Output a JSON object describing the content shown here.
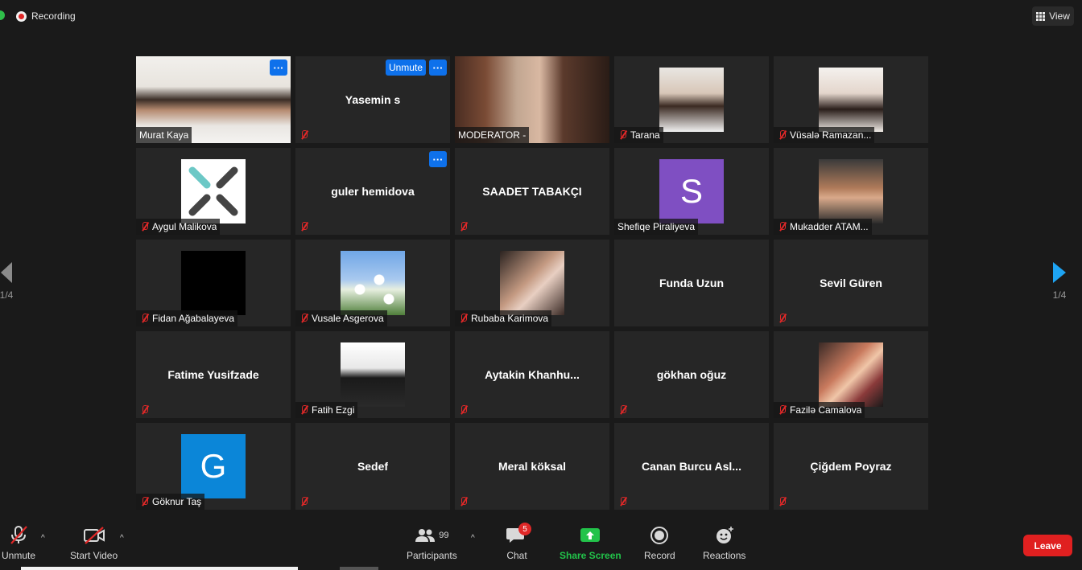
{
  "topbar": {
    "recording_label": "Recording",
    "view_label": "View"
  },
  "pager": {
    "left": "1/4",
    "right": "1/4"
  },
  "tiles": [
    {
      "name": "Murat Kaya",
      "muted": false,
      "kind": "video",
      "dots": true
    },
    {
      "name": "",
      "center": "Yasemin s",
      "muted": true,
      "kind": "name",
      "dots": true,
      "unmute": "Unmute"
    },
    {
      "name": "MODERATOR -",
      "muted": false,
      "kind": "video",
      "active": true
    },
    {
      "name": "Tarana",
      "muted": true,
      "kind": "photo"
    },
    {
      "name": "Vüsalə Ramazan...",
      "muted": true,
      "kind": "photo"
    },
    {
      "name": "Aygul Malikova",
      "muted": true,
      "kind": "photo"
    },
    {
      "name": "",
      "center": "guler hemidova",
      "muted": true,
      "kind": "name",
      "dots": true
    },
    {
      "name": "",
      "center": "SAADET TABAKÇI",
      "muted": true,
      "kind": "name"
    },
    {
      "name": "Shefiqe Piraliyeva",
      "muted": false,
      "kind": "letter",
      "letter": "S",
      "color": "#7f4fc2"
    },
    {
      "name": "Mukadder ATAM...",
      "muted": true,
      "kind": "photo"
    },
    {
      "name": "Fidan Ağabalayeva",
      "muted": true,
      "kind": "photo"
    },
    {
      "name": "Vusale Asgerova",
      "muted": true,
      "kind": "photo"
    },
    {
      "name": "Rubaba Karimova",
      "muted": true,
      "kind": "photo"
    },
    {
      "name": "",
      "center": "Funda Uzun",
      "muted": false,
      "kind": "name"
    },
    {
      "name": "",
      "center": "Sevil Güren",
      "muted": true,
      "kind": "name"
    },
    {
      "name": "",
      "center": "Fatime Yusifzade",
      "muted": true,
      "kind": "name"
    },
    {
      "name": "Fatih Ezgi",
      "muted": true,
      "kind": "photo"
    },
    {
      "name": "",
      "center": "Aytakin  Khanhu...",
      "muted": true,
      "kind": "name"
    },
    {
      "name": "",
      "center": "gökhan oğuz",
      "muted": true,
      "kind": "name"
    },
    {
      "name": "Fazilə Camalova",
      "muted": true,
      "kind": "photo"
    },
    {
      "name": "Göknur Taş",
      "muted": true,
      "kind": "letter",
      "letter": "G",
      "color": "#0b86d8"
    },
    {
      "name": "",
      "center": "Sedef",
      "muted": true,
      "kind": "name"
    },
    {
      "name": "",
      "center": "Meral köksal",
      "muted": true,
      "kind": "name"
    },
    {
      "name": "",
      "center": "Canan  Burcu  Asl...",
      "muted": true,
      "kind": "name"
    },
    {
      "name": "",
      "center": "Çiğdem Poyraz",
      "muted": true,
      "kind": "name"
    }
  ],
  "toolbar": {
    "unmute": "Unmute",
    "start_video": "Start Video",
    "participants": "Participants",
    "participants_count": "99",
    "chat": "Chat",
    "chat_badge": "5",
    "share_screen": "Share Screen",
    "record": "Record",
    "reactions": "Reactions",
    "leave": "Leave"
  },
  "colors": {
    "accent": "#0e71eb",
    "active_border": "#b8e04d",
    "share_green": "#22c34a",
    "leave_red": "#e02020"
  }
}
